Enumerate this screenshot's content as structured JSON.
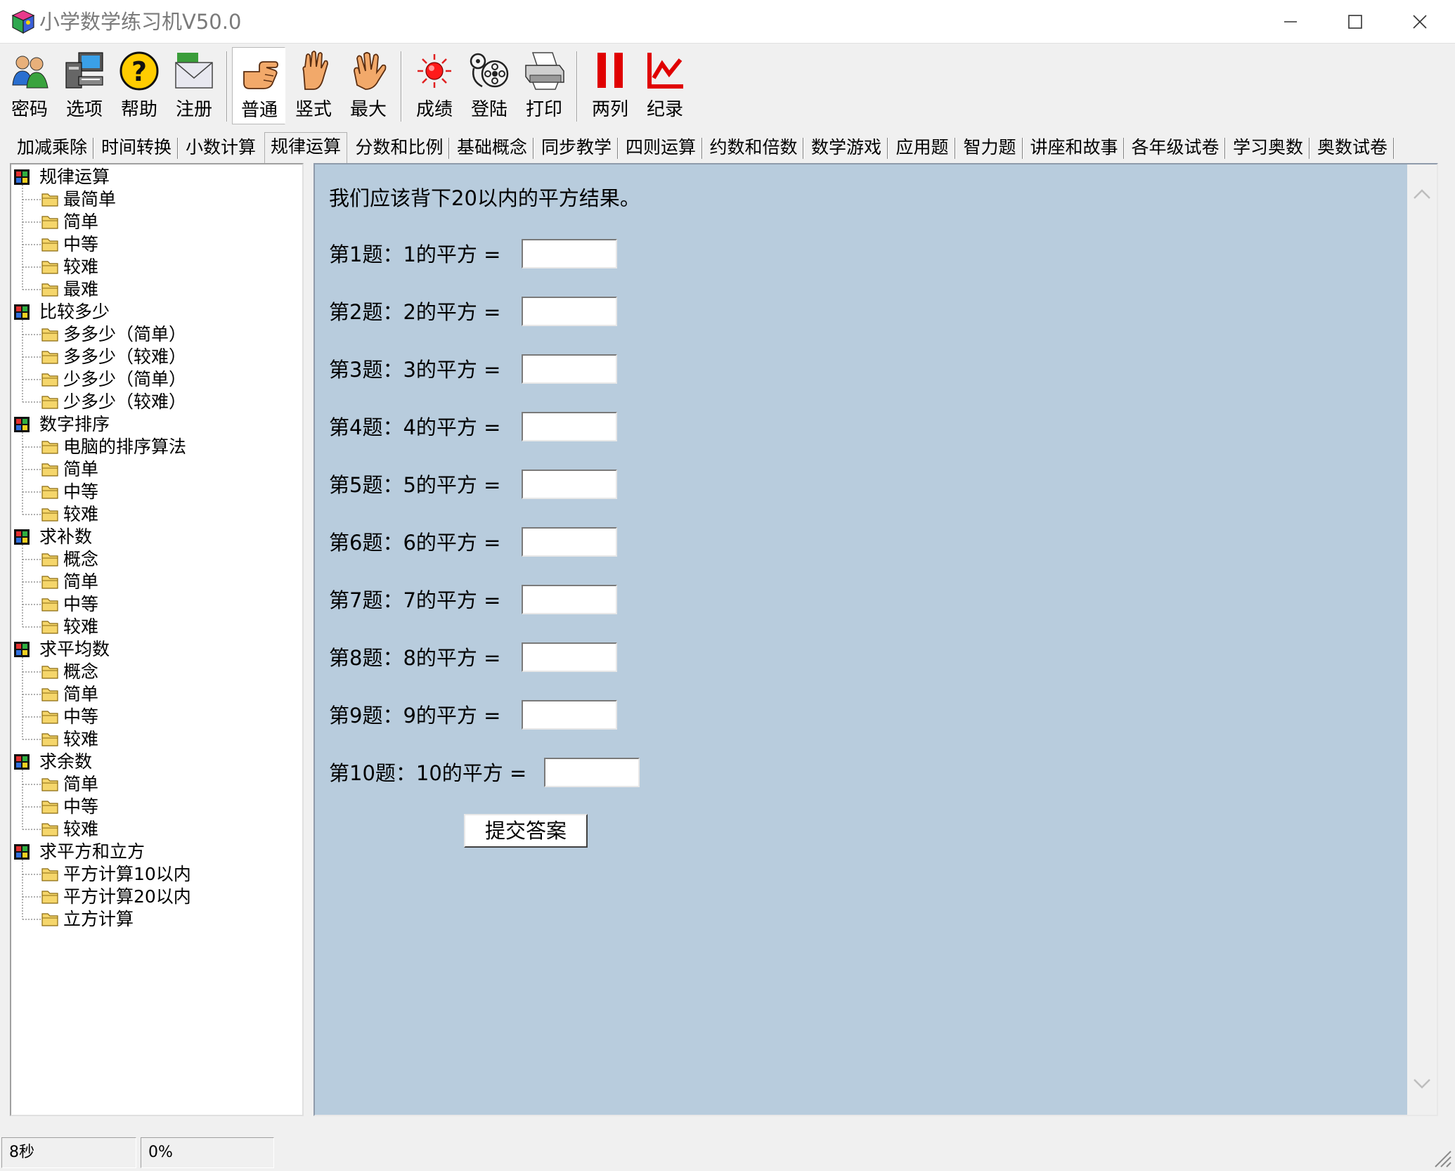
{
  "window": {
    "title": "小学数学练习机V50.0",
    "icon": "cube-app-icon",
    "controls": [
      "minimize-icon",
      "maximize-icon",
      "close-icon"
    ]
  },
  "toolbar": {
    "buttons": [
      {
        "label": "密码",
        "icon": "users-icon"
      },
      {
        "label": "选项",
        "icon": "computer-icon"
      },
      {
        "label": "帮助",
        "icon": "help-icon"
      },
      {
        "label": "注册",
        "icon": "envelope-icon"
      },
      {
        "label": "普通",
        "icon": "pointing-hand-icon",
        "active": true
      },
      {
        "label": "竖式",
        "icon": "raised-hand-icon"
      },
      {
        "label": "最大",
        "icon": "open-hand-icon"
      },
      {
        "label": "成绩",
        "icon": "red-light-icon"
      },
      {
        "label": "登陆",
        "icon": "film-reel-icon"
      },
      {
        "label": "打印",
        "icon": "printer-icon"
      },
      {
        "label": "两列",
        "icon": "two-columns-icon"
      },
      {
        "label": "纪录",
        "icon": "line-chart-icon"
      }
    ]
  },
  "tabs": [
    {
      "label": "加减乘除"
    },
    {
      "label": "时间转换"
    },
    {
      "label": "小数计算"
    },
    {
      "label": "规律运算",
      "active": true
    },
    {
      "label": "分数和比例"
    },
    {
      "label": "基础概念"
    },
    {
      "label": "同步教学"
    },
    {
      "label": "四则运算"
    },
    {
      "label": "约数和倍数"
    },
    {
      "label": "数学游戏"
    },
    {
      "label": "应用题"
    },
    {
      "label": "智力题"
    },
    {
      "label": "讲座和故事"
    },
    {
      "label": "各年级试卷"
    },
    {
      "label": "学习奥数"
    },
    {
      "label": "奥数试卷"
    }
  ],
  "tree": {
    "groups": [
      {
        "label": "规律运算",
        "items": [
          "最简单",
          "简单",
          "中等",
          "较难",
          "最难"
        ]
      },
      {
        "label": "比较多少",
        "items": [
          "多多少（简单）",
          "多多少（较难）",
          "少多少（简单）",
          "少多少（较难）"
        ]
      },
      {
        "label": "数字排序",
        "items": [
          "电脑的排序算法",
          "简单",
          "中等",
          "较难"
        ]
      },
      {
        "label": "求补数",
        "items": [
          "概念",
          "简单",
          "中等",
          "较难"
        ]
      },
      {
        "label": "求平均数",
        "items": [
          "概念",
          "简单",
          "中等",
          "较难"
        ]
      },
      {
        "label": "求余数",
        "items": [
          "简单",
          "中等",
          "较难"
        ]
      },
      {
        "label": "求平方和立方",
        "items": [
          "平方计算10以内",
          "平方计算20以内",
          "立方计算"
        ]
      }
    ]
  },
  "content": {
    "intro": "我们应该背下20以内的平方结果。",
    "questions": [
      {
        "label": "第1题：1的平方 =",
        "value": ""
      },
      {
        "label": "第2题：2的平方 =",
        "value": ""
      },
      {
        "label": "第3题：3的平方 =",
        "value": ""
      },
      {
        "label": "第4题：4的平方 =",
        "value": ""
      },
      {
        "label": "第5题：5的平方 =",
        "value": ""
      },
      {
        "label": "第6题：6的平方 =",
        "value": ""
      },
      {
        "label": "第7题：7的平方 =",
        "value": ""
      },
      {
        "label": "第8题：8的平方 =",
        "value": ""
      },
      {
        "label": "第9题：9的平方 =",
        "value": ""
      },
      {
        "label": "第10题：10的平方 =",
        "value": ""
      }
    ],
    "submit_label": "提交答案"
  },
  "status": {
    "timer": "8秒",
    "percent": "0%"
  },
  "colors": {
    "content_bg": "#b8ccdd",
    "tree_bg": "#ffffff",
    "folder_yellow": "#f5d66b"
  }
}
